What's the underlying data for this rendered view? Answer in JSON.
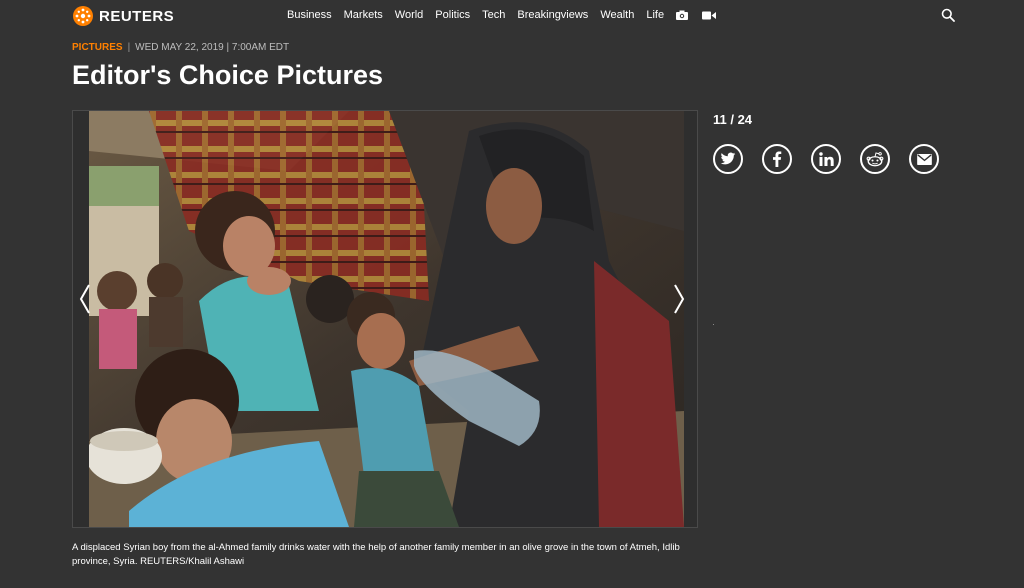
{
  "brand": {
    "name": "REUTERS",
    "accent": "#ff8000"
  },
  "nav": {
    "items": [
      "Business",
      "Markets",
      "World",
      "Politics",
      "Tech",
      "Breakingviews",
      "Wealth",
      "Life"
    ],
    "icons": [
      "camera-icon",
      "video-icon"
    ]
  },
  "search": {
    "icon": "search-icon"
  },
  "article": {
    "section": "PICTURES",
    "separator": "|",
    "date": "WED MAY 22, 2019 | 7:00AM EDT",
    "title": "Editor's Choice Pictures"
  },
  "gallery": {
    "counter": "11 / 24",
    "caption": "A displaced Syrian boy from the al-Ahmed family drinks water with the help of another family member in an olive grove in the town of Atmeh, Idlib province, Syria. REUTERS/Khalil Ashawi"
  },
  "share": [
    "twitter-icon",
    "facebook-icon",
    "linkedin-icon",
    "reddit-icon",
    "email-icon"
  ],
  "colors": {
    "background": "#333333",
    "text": "#ffffff",
    "meta": "#bdbdbd"
  }
}
